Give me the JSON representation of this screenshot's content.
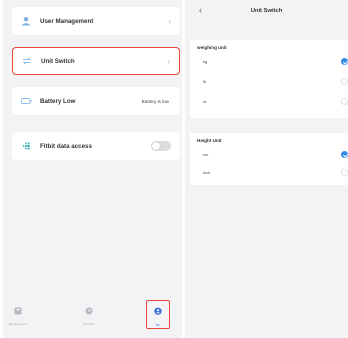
{
  "settings": {
    "items": [
      {
        "label": "User Management",
        "icon": "user-icon",
        "chevron": "›"
      },
      {
        "label": "Unit Switch",
        "icon": "swap-icon",
        "chevron": "›"
      },
      {
        "label": "Battery Low",
        "icon": "battery-icon",
        "value": "Battery is low"
      },
      {
        "label": "Fitbit data access",
        "icon": "fitbit-icon",
        "toggle_on": false
      }
    ]
  },
  "tabbar": {
    "tabs": [
      {
        "label": "Measurement",
        "icon": "scale-icon"
      },
      {
        "label": "Records",
        "icon": "history-icon"
      },
      {
        "label": "Me",
        "icon": "person-icon",
        "active": true
      }
    ]
  },
  "unit_switch": {
    "back": "‹",
    "title": "Unit Switch",
    "weight": {
      "title": "weighing unit",
      "options": [
        {
          "label": "kg",
          "selected": true
        },
        {
          "label": "lb",
          "selected": false
        },
        {
          "label": "st",
          "selected": false
        }
      ]
    },
    "height": {
      "title": "Height Unit",
      "options": [
        {
          "label": "cm",
          "selected": true
        },
        {
          "label": "inch",
          "selected": false
        }
      ]
    }
  },
  "colors": {
    "accent": "#2f8be6",
    "highlight": "#e8473a",
    "background": "#f3f3f5"
  }
}
